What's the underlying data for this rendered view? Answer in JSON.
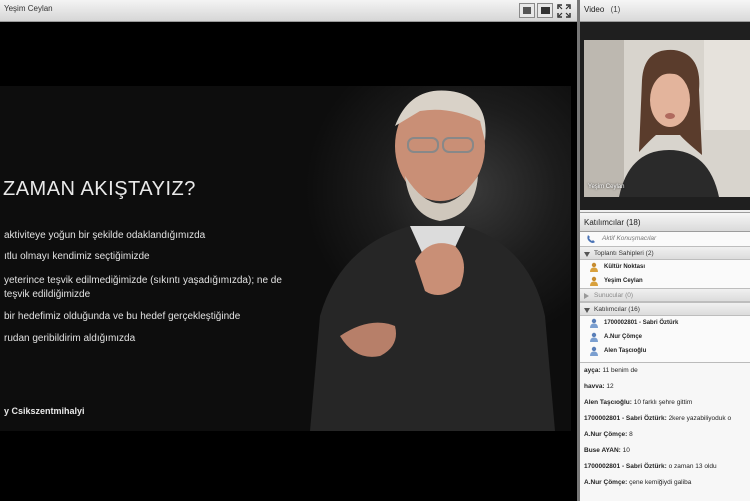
{
  "share": {
    "title": "Yeşim Ceylan"
  },
  "slide": {
    "title": "ZAMAN AKIŞTAYIZ?",
    "bullets": [
      "aktiviteye yoğun bir şekilde odaklandığımızda",
      "ıtlu olmayı kendimiz seçtiğimizde",
      "yeterince teşvik edilmediğimizde (sıkıntı yaşadığımızda); ne de",
      "teşvik edildiğimizde",
      "bir hedefimiz olduğunda ve bu hedef gerçekleştiğinde",
      "rudan geribildirim aldığımızda"
    ],
    "author": "y Csikszentmihalyi"
  },
  "video": {
    "title": "Video",
    "count": "(1)",
    "name": "Yeşim Ceylan"
  },
  "attendees": {
    "title": "Katılımcılar",
    "count": "(18)",
    "active_talkers": "Aktif Konuşmacılar",
    "hosts_group": "Toplantı Sahipleri (2)",
    "hosts": [
      "Kültür Noktası",
      "Yeşim Ceylan"
    ],
    "presenters_group": "Sunucular (0)",
    "participants_group": "Katılımcılar (16)",
    "participants": [
      "1700002801 - Sabri Öztürk",
      "A.Nur Çömçe",
      "Alen Taşcıoğlu"
    ]
  },
  "chat": {
    "messages": [
      {
        "who": "ayça:",
        "text": "11 benim de"
      },
      {
        "who": "havva:",
        "text": "12"
      },
      {
        "who": "Alen Taşcıoğlu:",
        "text": "10 farklı şehre gittim"
      },
      {
        "who": "1700002801 - Sabri Öztürk:",
        "text": "2kere yazabiliyoduk o"
      },
      {
        "who": "A.Nur Çömçe:",
        "text": "8"
      },
      {
        "who": "Buse AYAN:",
        "text": "10"
      },
      {
        "who": "1700002801 - Sabri Öztürk:",
        "text": "o zaman 13 oldu"
      },
      {
        "who": "A.Nur Çömçe:",
        "text": "çene kemiğiydi galiba"
      }
    ]
  },
  "colors": {
    "slide_bg": "#0d0d0d",
    "panel_bg": "#efefef",
    "header_grad_top": "#f6f6f6",
    "header_grad_bottom": "#d9d9d9"
  },
  "icons": [
    "layout-icon",
    "fullscreen-icon",
    "expand-icon",
    "phone-icon",
    "user-icon",
    "host-icon"
  ]
}
